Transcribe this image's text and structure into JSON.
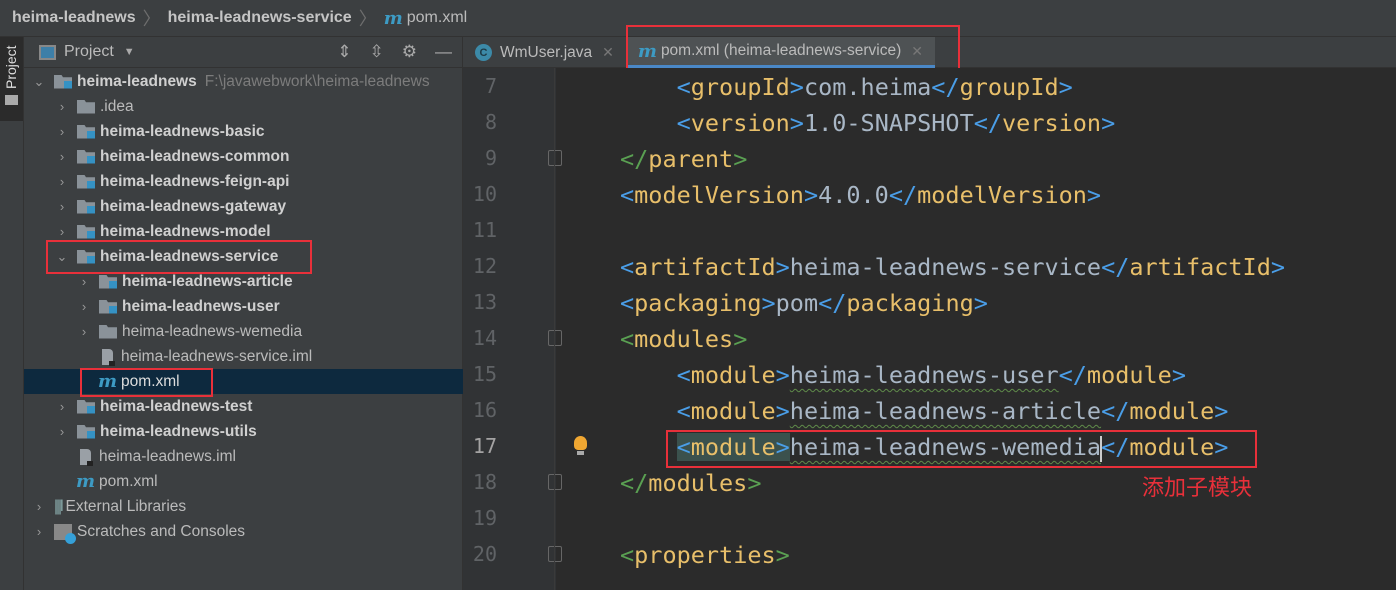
{
  "breadcrumb": [
    "heima-leadnews",
    "heima-leadnews-service",
    "pom.xml"
  ],
  "sidebar_stripe": {
    "label": "Project"
  },
  "project_panel": {
    "title": "Project",
    "root": {
      "name": "heima-leadnews",
      "path": "F:\\javawebwork\\heima-leadnews"
    },
    "items": [
      {
        "label": ".idea"
      },
      {
        "label": "heima-leadnews-basic"
      },
      {
        "label": "heima-leadnews-common"
      },
      {
        "label": "heima-leadnews-feign-api"
      },
      {
        "label": "heima-leadnews-gateway"
      },
      {
        "label": "heima-leadnews-model"
      },
      {
        "label": "heima-leadnews-service"
      },
      {
        "label": "heima-leadnews-article"
      },
      {
        "label": "heima-leadnews-user"
      },
      {
        "label": "heima-leadnews-wemedia"
      },
      {
        "label": "heima-leadnews-service.iml"
      },
      {
        "label": "pom.xml"
      },
      {
        "label": "heima-leadnews-test"
      },
      {
        "label": "heima-leadnews-utils"
      },
      {
        "label": "heima-leadnews.iml"
      },
      {
        "label": "pom.xml"
      },
      {
        "label": "External Libraries"
      },
      {
        "label": "Scratches and Consoles"
      }
    ]
  },
  "tabs": [
    {
      "label": "WmUser.java"
    },
    {
      "label": "pom.xml (heima-leadnews-service)",
      "active": true
    }
  ],
  "editor": {
    "current_line": 17,
    "lines": [
      {
        "n": "7",
        "tag": "groupId",
        "text": "com.heima"
      },
      {
        "n": "8",
        "tag": "version",
        "text": "1.0-SNAPSHOT"
      },
      {
        "n": "9",
        "close": "parent"
      },
      {
        "n": "10",
        "tag": "modelVersion",
        "text": "4.0.0"
      },
      {
        "n": "11"
      },
      {
        "n": "12",
        "tag": "artifactId",
        "text": "heima-leadnews-service"
      },
      {
        "n": "13",
        "tag": "packaging",
        "text": "pom"
      },
      {
        "n": "14",
        "open": "modules"
      },
      {
        "n": "15",
        "tag": "module",
        "text": "heima-leadnews-user"
      },
      {
        "n": "16",
        "tag": "module",
        "text": "heima-leadnews-article"
      },
      {
        "n": "17",
        "tag": "module",
        "text": "heima-leadnews-wemedia"
      },
      {
        "n": "18",
        "close": "modules"
      },
      {
        "n": "19"
      },
      {
        "n": "20",
        "open": "properties"
      }
    ]
  },
  "annotation": "添加子模块",
  "colors": {
    "highlight": "#e8303a",
    "accent": "#4a88c7",
    "tag": "#e8bf6a",
    "bracket": "#4a9ee8"
  }
}
